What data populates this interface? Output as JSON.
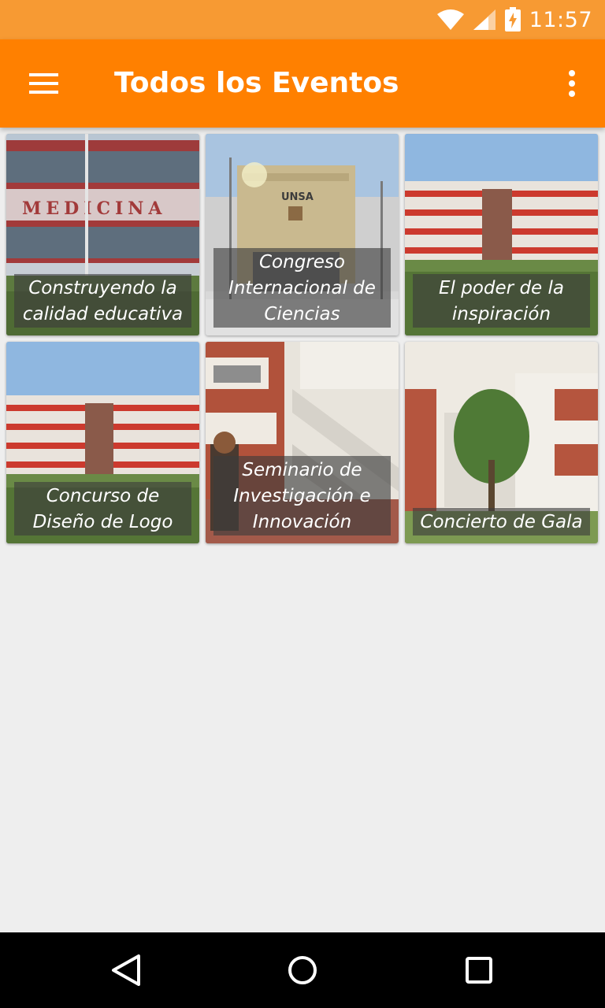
{
  "status_bar": {
    "time": "11:57",
    "icons": [
      "wifi-icon",
      "signal-icon",
      "battery-charging-icon"
    ],
    "color": "#f79a33"
  },
  "app_bar": {
    "title": "Todos los Eventos",
    "color": "#ff8000",
    "icons": [
      "hamburger-menu-icon",
      "more-vert-icon"
    ]
  },
  "events": [
    {
      "title": "Construyendo la calidad educativa",
      "image": "building-photo"
    },
    {
      "title": "Congreso Internacional de Ciencias",
      "image": "entrance-photo"
    },
    {
      "title": "El poder de la inspiración",
      "image": "campus-photo"
    },
    {
      "title": "Concurso de Diseño de Logo",
      "image": "campus-photo"
    },
    {
      "title": "Seminario de Investigación e Innovación",
      "image": "stairs-photo"
    },
    {
      "title": "Concierto de Gala",
      "image": "courtyard-photo"
    }
  ],
  "nav_bar": {
    "icons": [
      "back-icon",
      "home-icon",
      "recents-icon"
    ]
  }
}
